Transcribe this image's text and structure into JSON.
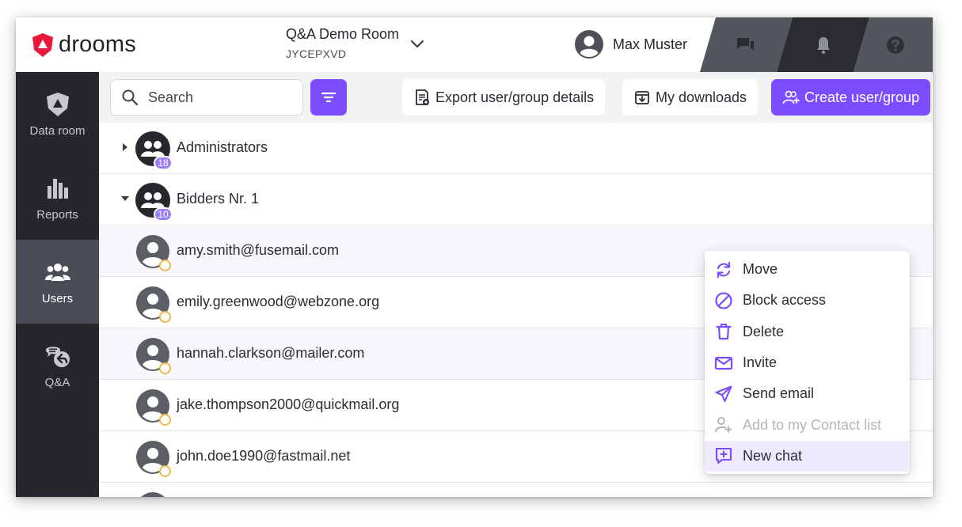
{
  "app": {
    "logo_text": "drooms",
    "accent_color": "#7c4dff",
    "brand_red": "#e8193c"
  },
  "header": {
    "room_name": "Q&A Demo Room",
    "room_code": "JYCEPXVD",
    "user_name": "Max Muster",
    "icons": [
      "chat-icon",
      "bell-icon",
      "help-icon"
    ]
  },
  "sidebar": {
    "items": [
      {
        "label": "Data room",
        "icon": "data-room-icon",
        "active": false
      },
      {
        "label": "Reports",
        "icon": "reports-icon",
        "active": false
      },
      {
        "label": "Users",
        "icon": "users-icon",
        "active": true
      },
      {
        "label": "Q&A",
        "icon": "qa-icon",
        "active": false
      }
    ]
  },
  "toolbar": {
    "search_placeholder": "Search",
    "export_label": "Export user/group details",
    "downloads_label": "My downloads",
    "create_label": "Create user/group"
  },
  "list": {
    "groups": [
      {
        "name": "Administrators",
        "count": "18",
        "expanded": false
      },
      {
        "name": "Bidders Nr. 1",
        "count": "10",
        "expanded": true
      }
    ],
    "users": [
      {
        "email": "amy.smith@fusemail.com"
      },
      {
        "email": "emily.greenwood@webzone.org"
      },
      {
        "email": "hannah.clarkson@mailer.com"
      },
      {
        "email": "jake.thompson2000@quickmail.org"
      },
      {
        "email": "john.doe1990@fastmail.net"
      }
    ]
  },
  "context_menu": {
    "items": [
      {
        "label": "Move",
        "icon": "move-icon",
        "disabled": false
      },
      {
        "label": "Block access",
        "icon": "block-icon",
        "disabled": false
      },
      {
        "label": "Delete",
        "icon": "trash-icon",
        "disabled": false
      },
      {
        "label": "Invite",
        "icon": "mail-icon",
        "disabled": false
      },
      {
        "label": "Send email",
        "icon": "send-icon",
        "disabled": false
      },
      {
        "label": "Add to my Contact list",
        "icon": "add-contact-icon",
        "disabled": true
      },
      {
        "label": "New chat",
        "icon": "new-chat-icon",
        "disabled": false,
        "highlighted": true
      }
    ]
  }
}
